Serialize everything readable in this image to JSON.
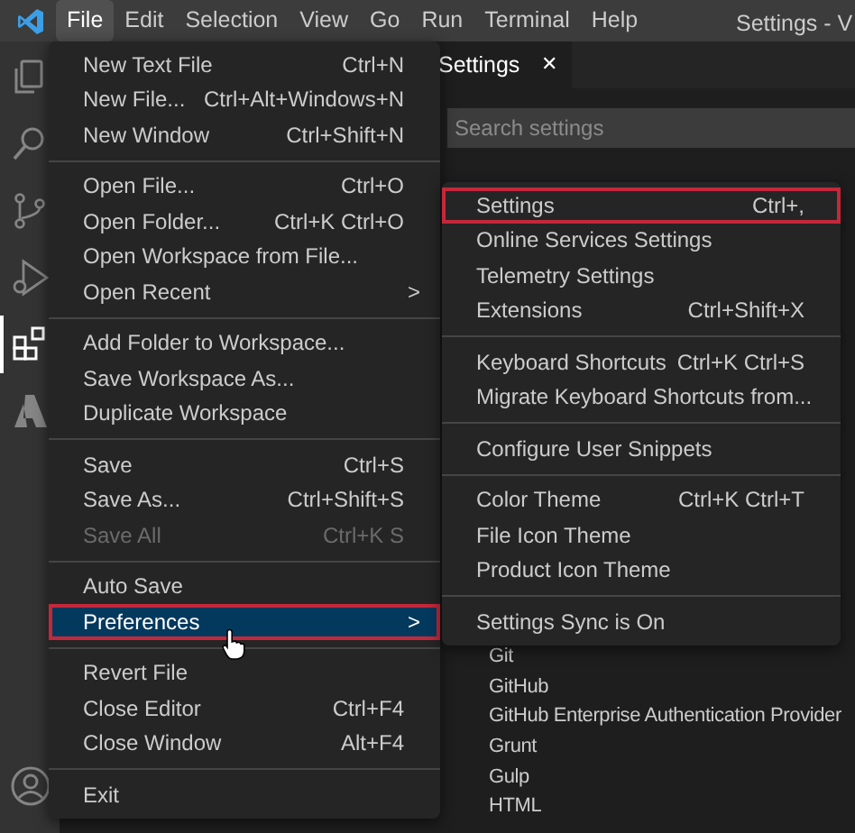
{
  "menu_bar": [
    {
      "label": "File",
      "selected": true
    },
    {
      "label": "Edit",
      "selected": false
    },
    {
      "label": "Selection",
      "selected": false
    },
    {
      "label": "View",
      "selected": false
    },
    {
      "label": "Go",
      "selected": false
    },
    {
      "label": "Run",
      "selected": false
    },
    {
      "label": "Terminal",
      "selected": false
    },
    {
      "label": "Help",
      "selected": false
    }
  ],
  "window": {
    "title": "Settings - V"
  },
  "activity_bar": [
    {
      "kind": "files",
      "selected": false
    },
    {
      "kind": "search",
      "selected": false
    },
    {
      "kind": "source-control",
      "selected": false
    },
    {
      "kind": "run",
      "selected": false
    },
    {
      "kind": "extensions",
      "selected": true
    },
    {
      "kind": "azure",
      "selected": false
    }
  ],
  "editor": {
    "tab": {
      "label": "Settings",
      "close": "✕"
    },
    "search": {
      "placeholder": "Search settings"
    },
    "tree": [
      "Git",
      "GitHub",
      "GitHub Enterprise Authentication Provider",
      "Grunt",
      "Gulp",
      "HTML"
    ]
  },
  "file_menu": [
    {
      "kind": "item",
      "label": "New Text File",
      "shortcut": "Ctrl+N",
      "disabled": false,
      "selected": false,
      "highlighted": false
    },
    {
      "kind": "item",
      "label": "New File...",
      "shortcut": "Ctrl+Alt+Windows+N",
      "disabled": false,
      "selected": false,
      "highlighted": false
    },
    {
      "kind": "item",
      "label": "New Window",
      "shortcut": "Ctrl+Shift+N",
      "disabled": false,
      "selected": false,
      "highlighted": false
    },
    {
      "kind": "separator"
    },
    {
      "kind": "item",
      "label": "Open File...",
      "shortcut": "Ctrl+O",
      "disabled": false,
      "selected": false,
      "highlighted": false
    },
    {
      "kind": "item",
      "label": "Open Folder...",
      "shortcut": "Ctrl+K Ctrl+O",
      "disabled": false,
      "selected": false,
      "highlighted": false
    },
    {
      "kind": "item",
      "label": "Open Workspace from File...",
      "disabled": false,
      "selected": false,
      "highlighted": false
    },
    {
      "kind": "item",
      "label": "Open Recent",
      "submenu_arrow": ">",
      "disabled": false,
      "selected": false,
      "highlighted": false
    },
    {
      "kind": "separator"
    },
    {
      "kind": "item",
      "label": "Add Folder to Workspace...",
      "disabled": false,
      "selected": false,
      "highlighted": false
    },
    {
      "kind": "item",
      "label": "Save Workspace As...",
      "disabled": false,
      "selected": false,
      "highlighted": false
    },
    {
      "kind": "item",
      "label": "Duplicate Workspace",
      "disabled": false,
      "selected": false,
      "highlighted": false
    },
    {
      "kind": "separator"
    },
    {
      "kind": "item",
      "label": "Save",
      "shortcut": "Ctrl+S",
      "disabled": false,
      "selected": false,
      "highlighted": false
    },
    {
      "kind": "item",
      "label": "Save As...",
      "shortcut": "Ctrl+Shift+S",
      "disabled": false,
      "selected": false,
      "highlighted": false
    },
    {
      "kind": "item",
      "label": "Save All",
      "shortcut": "Ctrl+K S",
      "disabled": true,
      "selected": false,
      "highlighted": false
    },
    {
      "kind": "separator"
    },
    {
      "kind": "item",
      "label": "Auto Save",
      "disabled": false,
      "selected": false,
      "highlighted": false
    },
    {
      "kind": "item",
      "label": "Preferences",
      "submenu_arrow": ">",
      "disabled": false,
      "selected": true,
      "highlighted": true
    },
    {
      "kind": "separator"
    },
    {
      "kind": "item",
      "label": "Revert File",
      "disabled": false,
      "selected": false,
      "highlighted": false
    },
    {
      "kind": "item",
      "label": "Close Editor",
      "shortcut": "Ctrl+F4",
      "disabled": false,
      "selected": false,
      "highlighted": false
    },
    {
      "kind": "item",
      "label": "Close Window",
      "shortcut": "Alt+F4",
      "disabled": false,
      "selected": false,
      "highlighted": false
    },
    {
      "kind": "separator"
    },
    {
      "kind": "item",
      "label": "Exit",
      "disabled": false,
      "selected": false,
      "highlighted": false
    }
  ],
  "preferences_menu": [
    {
      "kind": "item",
      "label": "Settings",
      "shortcut": "Ctrl+,",
      "highlighted": true
    },
    {
      "kind": "item",
      "label": "Online Services Settings",
      "highlighted": false
    },
    {
      "kind": "item",
      "label": "Telemetry Settings",
      "highlighted": false
    },
    {
      "kind": "item",
      "label": "Extensions",
      "shortcut": "Ctrl+Shift+X",
      "highlighted": false
    },
    {
      "kind": "separator"
    },
    {
      "kind": "item",
      "label": "Keyboard Shortcuts",
      "shortcut": "Ctrl+K Ctrl+S",
      "highlighted": false
    },
    {
      "kind": "item",
      "label": "Migrate Keyboard Shortcuts from...",
      "highlighted": false
    },
    {
      "kind": "separator"
    },
    {
      "kind": "item",
      "label": "Configure User Snippets",
      "highlighted": false
    },
    {
      "kind": "separator"
    },
    {
      "kind": "item",
      "label": "Color Theme",
      "shortcut": "Ctrl+K Ctrl+T",
      "highlighted": false
    },
    {
      "kind": "item",
      "label": "File Icon Theme",
      "highlighted": false
    },
    {
      "kind": "item",
      "label": "Product Icon Theme",
      "highlighted": false
    },
    {
      "kind": "separator"
    },
    {
      "kind": "item",
      "label": "Settings Sync is On",
      "highlighted": false
    }
  ]
}
